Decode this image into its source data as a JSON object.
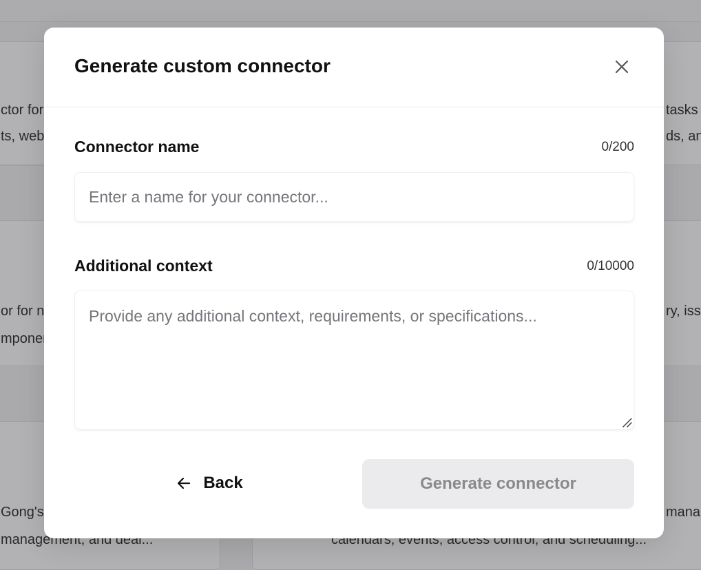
{
  "background": {
    "left_cards": [
      {
        "line1": "ctor for",
        "line2": "ts, web"
      },
      {
        "line1": "or for n",
        "line2": "mponer"
      },
      {
        "line1": "Gong's",
        "line2": "management, and deal..."
      }
    ],
    "right_cards": [
      {
        "line1": "tasks",
        "line2": "ds, an"
      },
      {
        "line1": "ry, iss",
        "line2": ""
      },
      {
        "line1": "mana",
        "line2": "calendars, events, access control, and scheduling..."
      }
    ]
  },
  "modal": {
    "title": "Generate custom connector",
    "close_icon": "close-icon",
    "name_field": {
      "label": "Connector name",
      "count": "0/200",
      "placeholder": "Enter a name for your connector...",
      "value": ""
    },
    "context_field": {
      "label": "Additional context",
      "count": "0/10000",
      "placeholder": "Provide any additional context, requirements, or specifications...",
      "value": ""
    },
    "back_button": {
      "label": "Back",
      "icon": "arrow-left-icon"
    },
    "generate_button": {
      "label": "Generate connector",
      "state": "disabled"
    }
  },
  "colors": {
    "overlay": "#a9a8ab",
    "modal_bg": "#ffffff",
    "disabled_button_bg": "#ebeaec",
    "disabled_button_text": "#8a898d"
  }
}
